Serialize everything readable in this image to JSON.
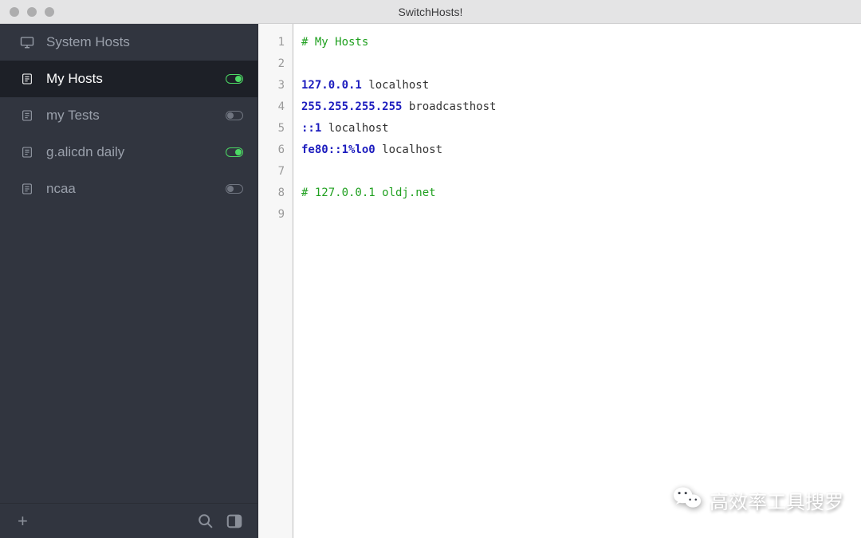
{
  "window": {
    "title": "SwitchHosts!"
  },
  "sidebar": {
    "items": [
      {
        "id": "system",
        "label": "System Hosts",
        "icon": "monitor",
        "toggle": null,
        "selected": false
      },
      {
        "id": "myhosts",
        "label": "My Hosts",
        "icon": "file",
        "toggle": "on",
        "selected": true
      },
      {
        "id": "mytests",
        "label": "my Tests",
        "icon": "file",
        "toggle": "off",
        "selected": false
      },
      {
        "id": "alicdn",
        "label": "g.alicdn daily",
        "icon": "file",
        "toggle": "on",
        "selected": false
      },
      {
        "id": "ncaa",
        "label": "ncaa",
        "icon": "file",
        "toggle": "off",
        "selected": false
      }
    ]
  },
  "editor": {
    "lines": [
      {
        "n": 1,
        "tokens": [
          {
            "t": "cm",
            "v": "# My Hosts"
          }
        ]
      },
      {
        "n": 2,
        "tokens": []
      },
      {
        "n": 3,
        "tokens": [
          {
            "t": "ip",
            "v": "127.0.0.1"
          },
          {
            "t": "",
            "v": " localhost"
          }
        ]
      },
      {
        "n": 4,
        "tokens": [
          {
            "t": "ip",
            "v": "255.255.255.255"
          },
          {
            "t": "",
            "v": " broadcasthost"
          }
        ]
      },
      {
        "n": 5,
        "tokens": [
          {
            "t": "ip",
            "v": "::1"
          },
          {
            "t": "",
            "v": " localhost"
          }
        ]
      },
      {
        "n": 6,
        "tokens": [
          {
            "t": "ip",
            "v": "fe80::1%lo0"
          },
          {
            "t": "",
            "v": " localhost"
          }
        ]
      },
      {
        "n": 7,
        "tokens": []
      },
      {
        "n": 8,
        "tokens": [
          {
            "t": "cm",
            "v": "# 127.0.0.1 oldj.net"
          }
        ]
      },
      {
        "n": 9,
        "tokens": []
      }
    ]
  },
  "watermark": {
    "text": "高效率工具搜罗"
  },
  "glyphs": {
    "add": "+"
  }
}
